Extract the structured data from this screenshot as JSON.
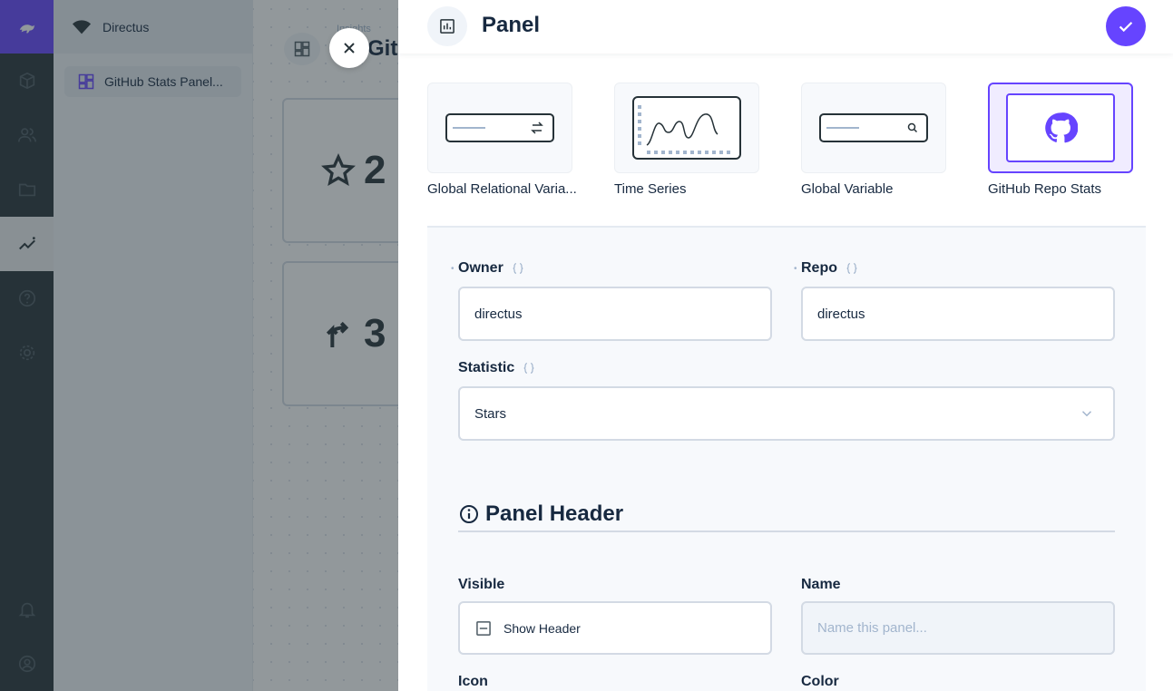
{
  "app": {
    "project_name": "Directus",
    "nav_item": "GitHub Stats Panel...",
    "breadcrumb": "Insights",
    "dashboard_title": "GitHub Stats",
    "card_values": [
      "2",
      "3"
    ]
  },
  "drawer": {
    "title": "Panel",
    "panel_types": [
      {
        "label": "Global Relational Varia..."
      },
      {
        "label": "Time Series"
      },
      {
        "label": "Global Variable"
      },
      {
        "label": "GitHub Repo Stats"
      }
    ],
    "fields": {
      "owner": {
        "label": "Owner",
        "value": "directus"
      },
      "repo": {
        "label": "Repo",
        "value": "directus"
      },
      "statistic": {
        "label": "Statistic",
        "value": "Stars"
      }
    },
    "header_section": {
      "title": "Panel Header",
      "visible_label": "Visible",
      "show_header_label": "Show Header",
      "name_label": "Name",
      "name_placeholder": "Name this panel...",
      "icon_label": "Icon",
      "color_label": "Color"
    }
  },
  "colors": {
    "accent": "#6644ff",
    "rail": "#263238",
    "text": "#172940",
    "muted": "#a2b5cd",
    "border": "#d3dae4"
  },
  "icons": {
    "panel_header_icon": "insert-chart-icon",
    "confirm": "check-icon",
    "close": "close-icon",
    "refresh": "raw-value-icon",
    "dropdown": "chevron-down-icon",
    "info": "info-icon",
    "checkbox": "indeterminate-checkbox-icon"
  }
}
